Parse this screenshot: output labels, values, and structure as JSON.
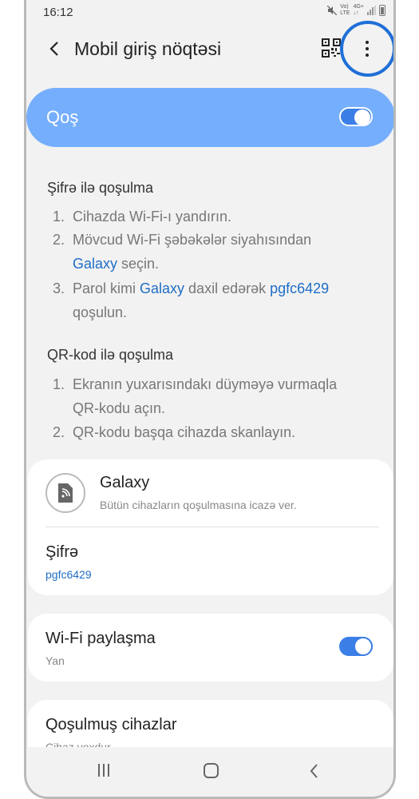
{
  "status_bar": {
    "time": "16:12",
    "volte_label": "Vo)\nLTE",
    "network_label": "4G+"
  },
  "header": {
    "title": "Mobil giriş nöqtəsi"
  },
  "master_switch": {
    "label": "Qoş",
    "state": "on"
  },
  "password_section": {
    "heading": "Şifrə ilə qoşulma",
    "step1_num": "1.",
    "step1": "Cihazda Wi-Fi-ı yandırın.",
    "step2_num": "2.",
    "step2_line1": "Mövcud Wi-Fi şəbəkələr siyahısından",
    "step2_link": "Galaxy",
    "step2_tail": " seçin.",
    "step3_num": "3.",
    "step3_pre": "Parol kimi ",
    "step3_link1": "Galaxy",
    "step3_mid": " daxil edərək ",
    "step3_link2": "pgfc6429",
    "step3_line2": "qoşulun."
  },
  "qr_section": {
    "heading": "QR-kod ilə qoşulma",
    "step1_num": "1.",
    "step1_line1": "Ekranın yuxarısındakı düyməyə vurmaqla",
    "step1_line2": "QR-kodu açın.",
    "step2_num": "2.",
    "step2": "QR-kodu başqa cihazda skanlayın."
  },
  "network_card": {
    "name": "Galaxy",
    "subtitle": "Bütün cihazların qoşulmasına icazə ver.",
    "password_label": "Şifrə",
    "password_value": "pgfc6429"
  },
  "wifi_sharing": {
    "title": "Wi-Fi paylaşma",
    "subtitle": "Yan",
    "state": "on"
  },
  "connected_devices": {
    "title": "Qoşulmuş cihazlar",
    "subtitle": "Cihaz yoxdur"
  },
  "colors": {
    "accent": "#3b7fe6",
    "master_bg": "#75aefc",
    "link": "#1f6ec6",
    "highlight": "#1f6fd6"
  }
}
